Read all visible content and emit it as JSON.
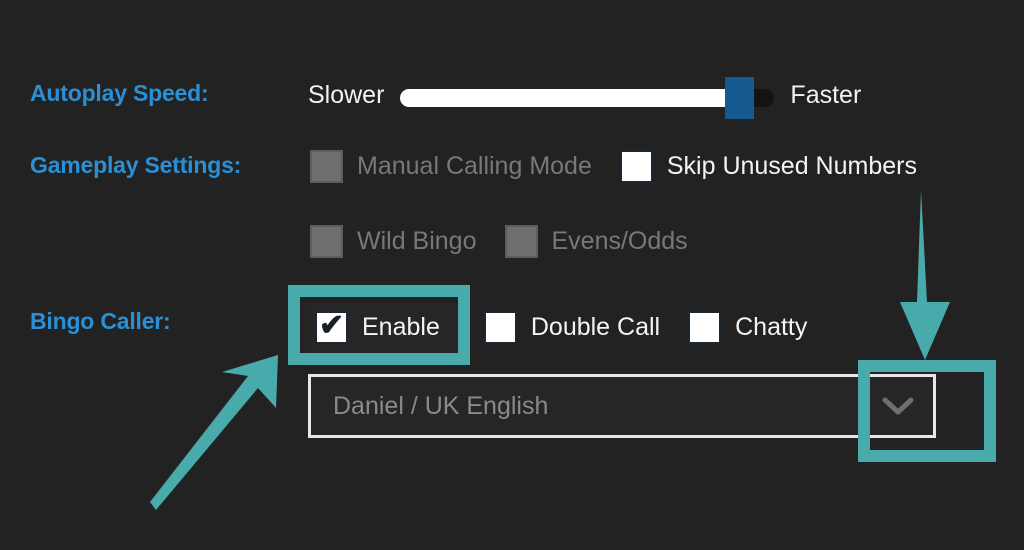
{
  "theme": {
    "background": "#222222",
    "label_blue": "#2b8fd4",
    "text_on": "#f4f4f4",
    "text_off": "#787878",
    "annotation_teal": "#49aaab",
    "slider_thumb_blue": "#14598f"
  },
  "rows": {
    "autoplay": {
      "label": "Autoplay Speed:",
      "slider": {
        "min_label": "Slower",
        "max_label": "Faster",
        "value_percent": 88
      }
    },
    "gameplay": {
      "label": "Gameplay Settings:",
      "options": [
        {
          "label": "Manual Calling Mode",
          "checked": false,
          "disabled": true
        },
        {
          "label": "Skip Unused Numbers",
          "checked": false,
          "disabled": false
        },
        {
          "label": "Wild Bingo",
          "checked": false,
          "disabled": true
        },
        {
          "label": "Evens/Odds",
          "checked": false,
          "disabled": true
        }
      ]
    },
    "caller": {
      "label": "Bingo Caller:",
      "options": [
        {
          "label": "Enable",
          "checked": true,
          "disabled": false
        },
        {
          "label": "Double Call",
          "checked": false,
          "disabled": false
        },
        {
          "label": "Chatty",
          "checked": false,
          "disabled": false
        }
      ],
      "voice_select": {
        "value": "Daniel / UK English",
        "caret_icon": "chevron-down-icon"
      }
    }
  },
  "annotations": {
    "highlight_enable": "highlight-box-enable-checkbox",
    "highlight_caret": "highlight-box-dropdown-caret",
    "arrow_down": "arrow-down-icon",
    "arrow_diagonal": "arrow-up-right-icon"
  },
  "icons": {
    "checkmark": "✔"
  }
}
